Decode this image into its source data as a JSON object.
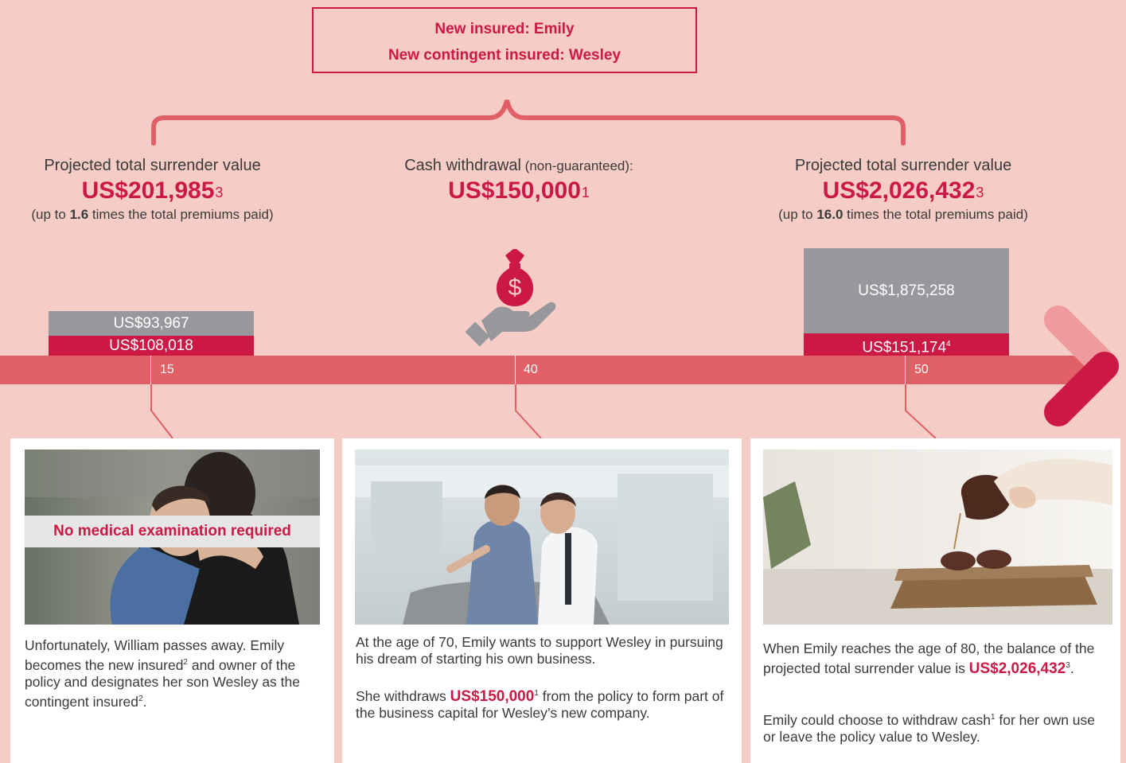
{
  "header_box": {
    "line1": "New insured: Emily",
    "line2": "New contingent insured: Wesley"
  },
  "left_stat": {
    "label": "Projected total surrender value",
    "amount": "US$201,985",
    "note": "3",
    "sub_pre": "(up to ",
    "sub_bold": "1.6",
    "sub_post": " times the total premiums paid)"
  },
  "mid_stat": {
    "label": "Cash withdrawal",
    "label_small": " (non-guaranteed):",
    "amount": "US$150,000",
    "note": "1"
  },
  "right_stat": {
    "label": "Projected total surrender value",
    "amount": "US$2,026,432",
    "note": "3",
    "sub_pre": "(up to ",
    "sub_bold": "16.0",
    "sub_post": " times the total premiums paid)"
  },
  "bars": {
    "left_grey": "US$93,967",
    "left_red": "US$108,018",
    "right_grey": "US$1,875,258",
    "right_red": "US$151,174",
    "right_red_note": "4"
  },
  "timeline": {
    "ticks": [
      "15",
      "40",
      "50"
    ]
  },
  "cards": {
    "card1": {
      "t1": "Unfortunately, William passes away. Emily becomes the new insured",
      "n1": "2",
      "t2": " and owner of the policy and designates her son Wesley as the contingent insured",
      "n2": "2",
      "t3": ".",
      "badge": "No medical examination required"
    },
    "card2": {
      "p1": "At the age of 70, Emily wants to support Wesley in pursuing his dream of starting his own business.",
      "p2_pre": "She withdraws ",
      "p2_amount": "US$150,000",
      "p2_note": "1",
      "p2_post": " from the policy to form part of the business capital for Wesley’s new company."
    },
    "card3": {
      "p1_pre": "When Emily reaches the age of 80, the balance of the projected total surrender value is ",
      "p1_amount": "US$2,026,432",
      "p1_note": "3",
      "p1_post": ".",
      "p2_pre": "Emily could choose to withdraw cash",
      "p2_note": "1",
      "p2_post": " for her own use or leave the policy value to Wesley."
    }
  },
  "colors": {
    "background": "#f6cdc6",
    "accent_red": "#cc1844",
    "timeline": "#e06066",
    "bar_grey": "#96989c"
  },
  "icons": [
    "money-bag-hand-icon",
    "timeline-arrow-icon"
  ]
}
